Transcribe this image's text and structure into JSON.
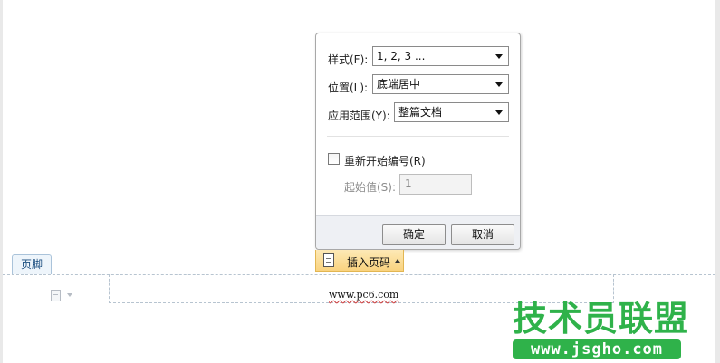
{
  "dialog": {
    "style_label": "样式(F):",
    "style_value": "1, 2, 3 ...",
    "position_label": "位置(L):",
    "position_value": "底端居中",
    "scope_label": "应用范围(Y):",
    "scope_value": "整篇文档",
    "restart_label": "重新开始编号(R)",
    "restart_checked": false,
    "start_label": "起始值(S):",
    "start_value": "1",
    "ok_label": "确定",
    "cancel_label": "取消"
  },
  "insert_tab": {
    "label": "插入页码"
  },
  "footer_tab": {
    "label": "页脚"
  },
  "footer": {
    "text": "www.pc6.com"
  },
  "watermark": {
    "title": "技术员联盟",
    "url": "www.jsgho.com"
  },
  "colors": {
    "watermark_green": "#2fb24a",
    "tab_gold": "#f9d37f",
    "footer_tab_blue": "#1d4f80"
  }
}
